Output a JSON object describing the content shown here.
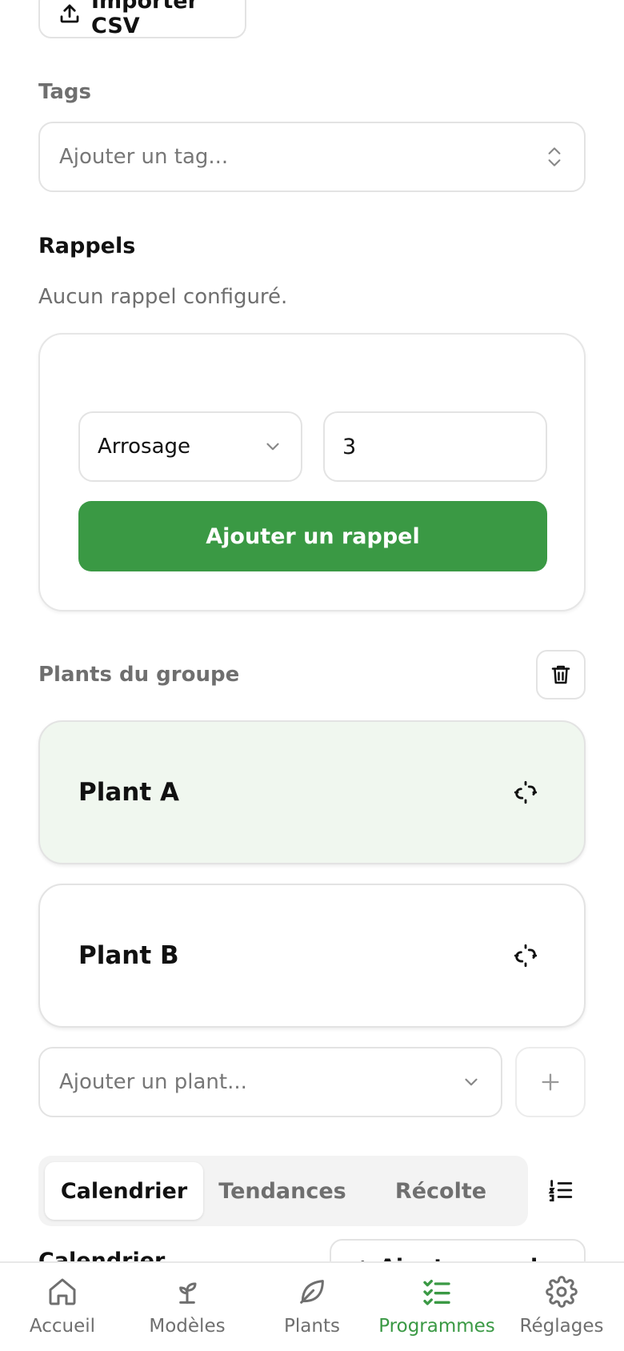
{
  "import_button": {
    "label": "Importer CSV",
    "icon": "upload-icon"
  },
  "tags": {
    "label": "Tags",
    "placeholder": "Ajouter un tag...",
    "icon": "chevron-up-down-icon"
  },
  "reminders": {
    "title": "Rappels",
    "empty_text": "Aucun rappel configuré.",
    "type_value": "Arrosage",
    "days_value": "3",
    "add_button": "Ajouter un rappel"
  },
  "group": {
    "label": "Plants du groupe",
    "delete_icon": "trash-icon",
    "plants": [
      {
        "name": "Plant A",
        "selected": true,
        "icon": "unlink-icon"
      },
      {
        "name": "Plant B",
        "selected": false,
        "icon": "unlink-icon"
      }
    ],
    "add_plant_placeholder": "Ajouter un plant...",
    "add_icon": "plus-icon"
  },
  "tabs": {
    "items": [
      {
        "label": "Calendrier",
        "active": true
      },
      {
        "label": "Tendances",
        "active": false
      },
      {
        "label": "Récolte",
        "active": false
      }
    ],
    "list_icon": "ordered-list-icon"
  },
  "peek": {
    "heading": "Calendrier",
    "button": "+ Ajouter un plan"
  },
  "bottom_nav": [
    {
      "label": "Accueil",
      "icon": "home-icon",
      "active": false
    },
    {
      "label": "Modèles",
      "icon": "sprout-icon",
      "active": false
    },
    {
      "label": "Plants",
      "icon": "leaf-icon",
      "active": false
    },
    {
      "label": "Programmes",
      "icon": "checklist-icon",
      "active": true
    },
    {
      "label": "Réglages",
      "icon": "gear-icon",
      "active": false
    }
  ],
  "colors": {
    "accent": "#3a9944",
    "selected_card": "#f0f7ef",
    "muted": "#6f6f6f"
  }
}
